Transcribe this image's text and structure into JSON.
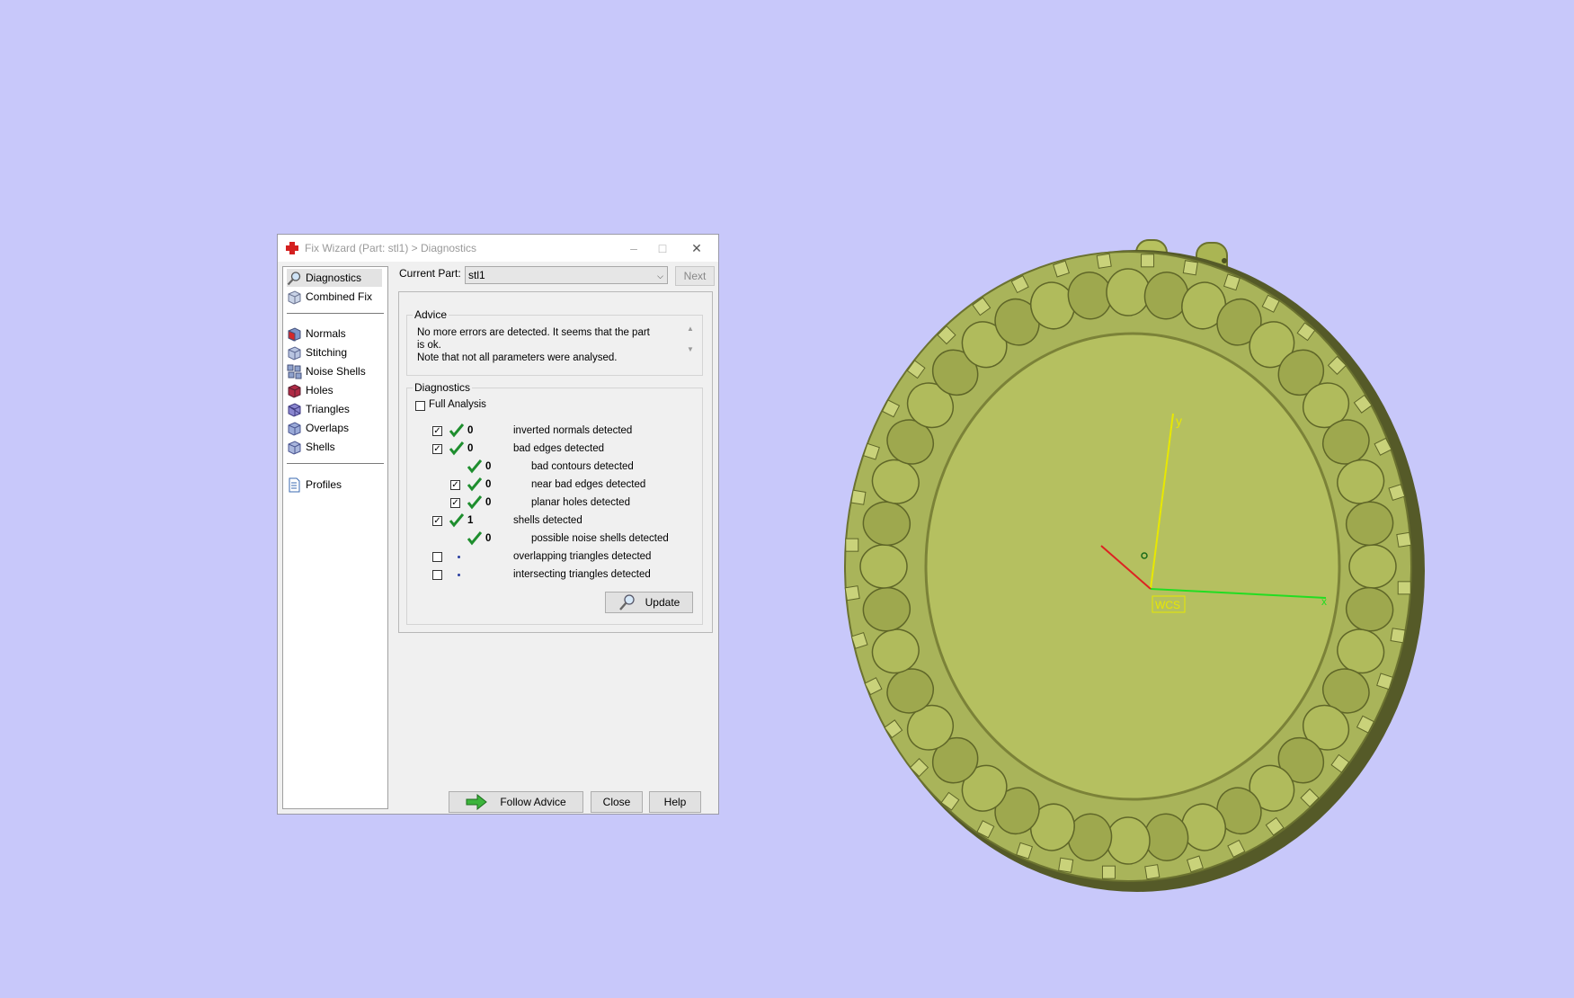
{
  "window": {
    "title": "Fix Wizard (Part: stl1) > Diagnostics"
  },
  "sidebar": {
    "items": [
      {
        "label": "Diagnostics",
        "icon": "magnifier-icon"
      },
      {
        "label": "Combined Fix",
        "icon": "cube-icon"
      },
      {
        "label": "Normals",
        "icon": "cube-red-icon"
      },
      {
        "label": "Stitching",
        "icon": "cube-icon"
      },
      {
        "label": "Noise Shells",
        "icon": "noise-shells-icon"
      },
      {
        "label": "Holes",
        "icon": "cube-red-icon"
      },
      {
        "label": "Triangles",
        "icon": "cube-purple-icon"
      },
      {
        "label": "Overlaps",
        "icon": "cube-icon"
      },
      {
        "label": "Shells",
        "icon": "cube-icon"
      },
      {
        "label": "Profiles",
        "icon": "document-icon"
      }
    ]
  },
  "toolbar": {
    "current_part_label": "Current Part:",
    "current_part_value": "stl1",
    "next_label": "Next"
  },
  "advice": {
    "title": "Advice",
    "line1": "No more errors are detected. It seems that the part is ok.",
    "line2": "Note that not all parameters were analysed."
  },
  "diagnostics": {
    "title": "Diagnostics",
    "full_analysis_label": "Full Analysis",
    "rows": [
      {
        "count": "0",
        "label": "inverted normals detected",
        "checked": true,
        "status": "ok"
      },
      {
        "count": "0",
        "label": "bad edges detected",
        "checked": true,
        "status": "ok"
      },
      {
        "count": "0",
        "label": "bad contours detected",
        "checked": null,
        "status": "ok"
      },
      {
        "count": "0",
        "label": "near bad edges detected",
        "checked": true,
        "status": "ok"
      },
      {
        "count": "0",
        "label": "planar holes detected",
        "checked": true,
        "status": "ok"
      },
      {
        "count": "1",
        "label": "shells detected",
        "checked": true,
        "status": "ok"
      },
      {
        "count": "0",
        "label": "possible noise shells detected",
        "checked": null,
        "status": "ok"
      },
      {
        "count": "",
        "label": "overlapping triangles detected",
        "checked": false,
        "status": "pending"
      },
      {
        "count": "",
        "label": "intersecting triangles detected",
        "checked": false,
        "status": "pending"
      }
    ],
    "update_label": "Update"
  },
  "footer": {
    "follow_advice_label": "Follow Advice",
    "close_label": "Close",
    "help_label": "Help"
  },
  "viewport": {
    "wcs_label": "WCS",
    "axis_y": "y",
    "axis_x": "x",
    "model_color": "#b5c060",
    "background": "#c8c8fa"
  }
}
